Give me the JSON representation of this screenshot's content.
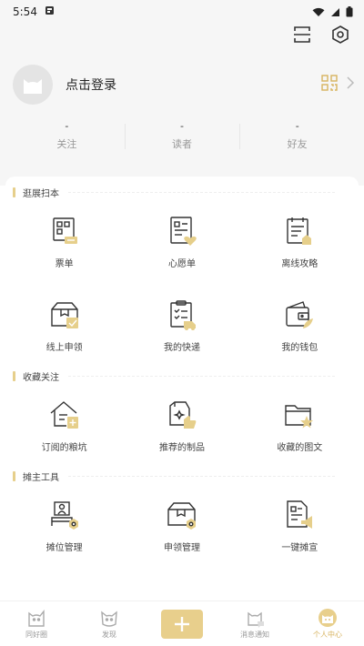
{
  "status_bar": {
    "time": "5:54"
  },
  "profile": {
    "login_label": "点击登录"
  },
  "stats": [
    {
      "value": "-",
      "label": "关注"
    },
    {
      "value": "-",
      "label": "读者"
    },
    {
      "value": "-",
      "label": "好友"
    }
  ],
  "sections": [
    {
      "title": "逛展扫本",
      "items": [
        {
          "label": "票单",
          "icon": "ticket-icon"
        },
        {
          "label": "心愿单",
          "icon": "wishlist-icon"
        },
        {
          "label": "离线攻略",
          "icon": "offline-guide-icon"
        },
        {
          "label": "线上申领",
          "icon": "online-claim-icon"
        },
        {
          "label": "我的快递",
          "icon": "delivery-icon"
        },
        {
          "label": "我的钱包",
          "icon": "wallet-icon"
        }
      ]
    },
    {
      "title": "收藏关注",
      "items": [
        {
          "label": "订阅的粮坑",
          "icon": "subscribed-icon"
        },
        {
          "label": "推荐的制品",
          "icon": "recommended-icon"
        },
        {
          "label": "收藏的图文",
          "icon": "favorites-icon"
        }
      ]
    },
    {
      "title": "摊主工具",
      "items": [
        {
          "label": "摊位管理",
          "icon": "booth-manage-icon"
        },
        {
          "label": "申领管理",
          "icon": "claim-manage-icon"
        },
        {
          "label": "一键摊宣",
          "icon": "promote-icon"
        }
      ]
    }
  ],
  "tabs": [
    {
      "label": "同好圈"
    },
    {
      "label": "发现"
    },
    {
      "label": ""
    },
    {
      "label": "消息通知"
    },
    {
      "label": "个人中心"
    }
  ],
  "colors": {
    "accent": "#e6cf8b",
    "active_tab": "#d7b35f"
  }
}
